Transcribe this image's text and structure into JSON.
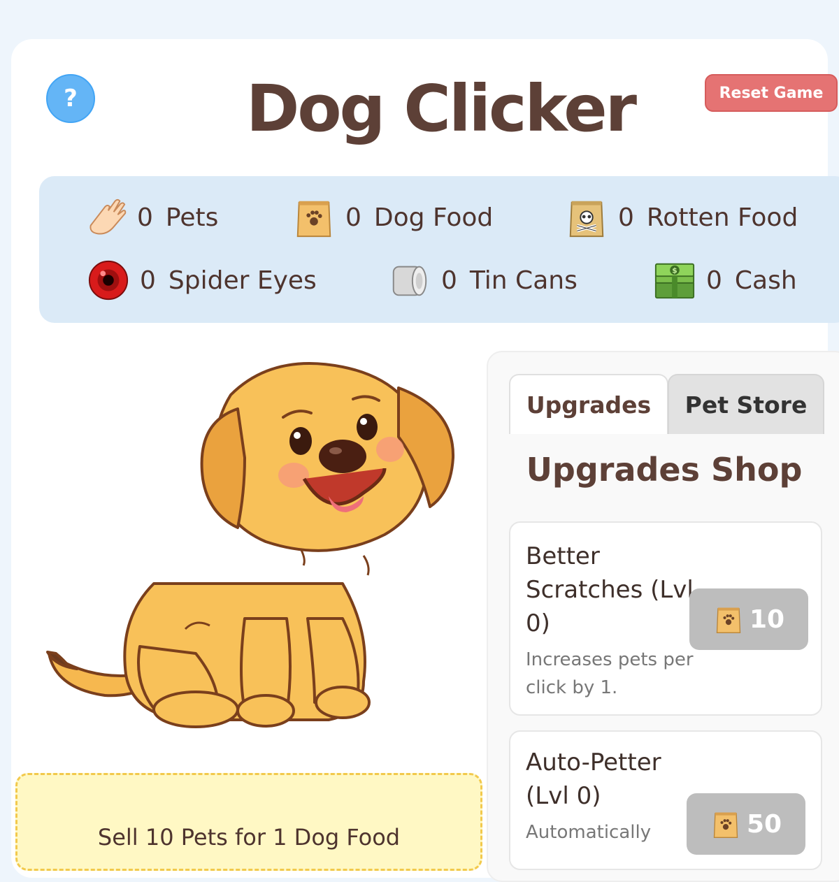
{
  "header": {
    "help_label": "?",
    "title": "Dog Clicker",
    "reset_label": "Reset Game"
  },
  "resources": [
    {
      "icon": "hand-icon",
      "count": "0",
      "label": "Pets"
    },
    {
      "icon": "dog-food-bag-icon",
      "count": "0",
      "label": "Dog Food"
    },
    {
      "icon": "rotten-food-bag-icon",
      "count": "0",
      "label": "Rotten Food"
    },
    {
      "icon": "spider-eye-icon",
      "count": "0",
      "label": "Spider Eyes"
    },
    {
      "icon": "tin-can-icon",
      "count": "0",
      "label": "Tin Cans"
    },
    {
      "icon": "cash-stack-icon",
      "count": "0",
      "label": "Cash"
    }
  ],
  "sell": {
    "label": "Sell 10 Pets for 1 Dog Food"
  },
  "shop": {
    "tabs": [
      {
        "label": "Upgrades",
        "active": true
      },
      {
        "label": "Pet Store",
        "active": false
      }
    ],
    "title": "Upgrades Shop",
    "upgrades": [
      {
        "name": "Better Scratches (Lvl 0)",
        "description": "Increases pets per click by 1.",
        "cost": "10",
        "cost_icon": "dog-food-bag-icon"
      },
      {
        "name": "Auto-Petter (Lvl 0)",
        "description": "Automatically",
        "cost": "50",
        "cost_icon": "dog-food-bag-icon"
      }
    ]
  },
  "colors": {
    "page_bg": "#eef5fc",
    "resource_panel": "#dbeaf7",
    "title_brown": "#5d4037",
    "reset_red": "#e57373",
    "help_blue": "#64b5f6",
    "sell_yellow": "#fff8c4",
    "buy_disabled": "#bdbdbd"
  }
}
